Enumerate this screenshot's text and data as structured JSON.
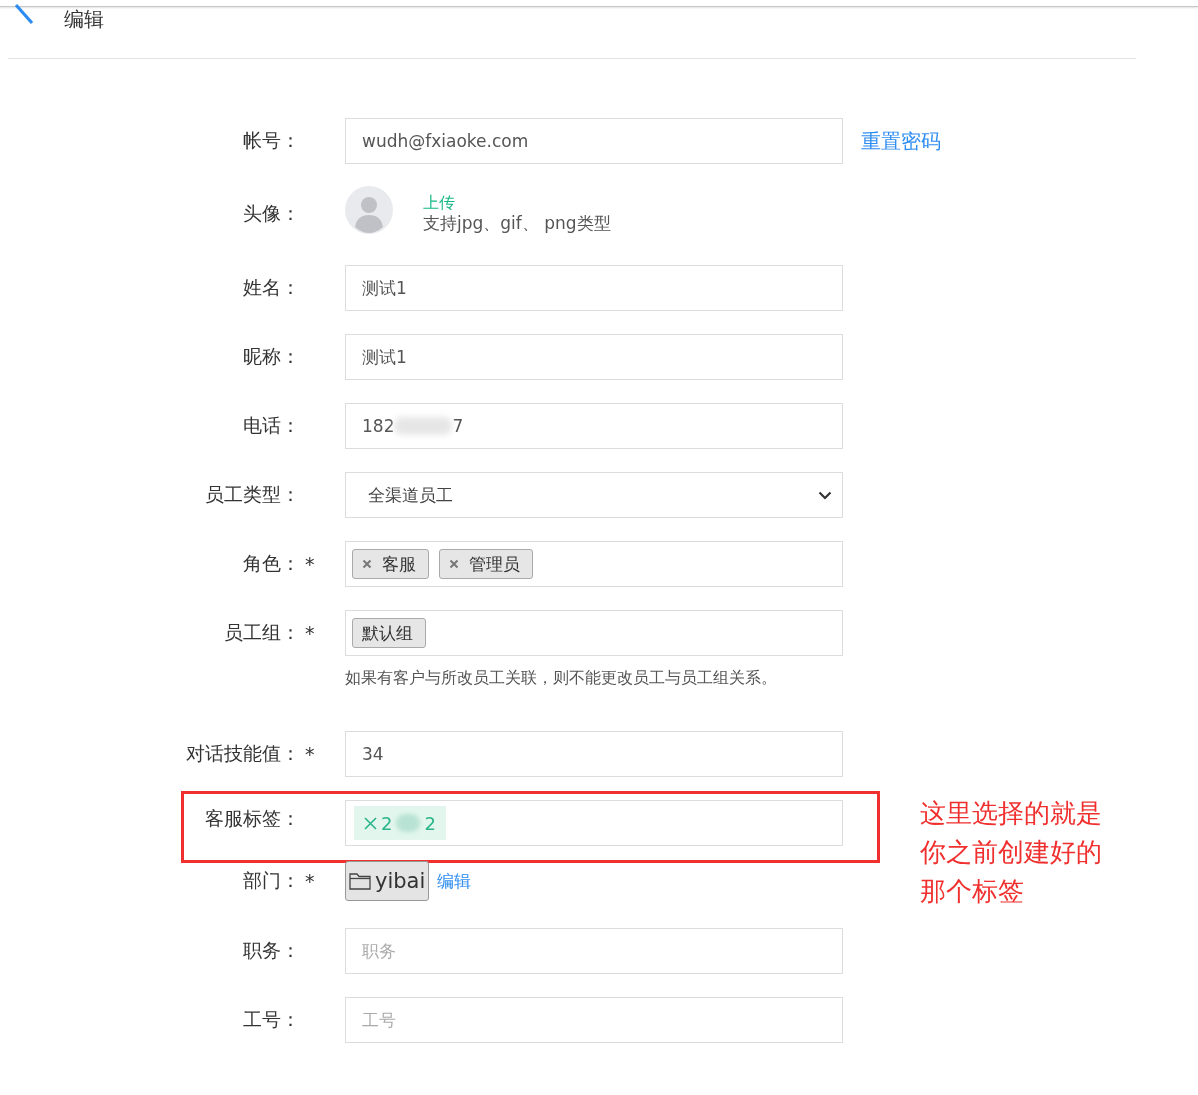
{
  "header": {
    "title": "编辑"
  },
  "fields": [
    {
      "kind": "text",
      "label": "帐号：",
      "value": "wudh@fxiaoke.com",
      "link": "重置密码"
    },
    {
      "kind": "avatar",
      "label": "头像：",
      "upload": "上传",
      "hint": "支持jpg、gif、 png类型"
    },
    {
      "kind": "text",
      "label": "姓名：",
      "value": "测试1"
    },
    {
      "kind": "text",
      "label": "昵称：",
      "value": "测试1"
    },
    {
      "kind": "masked",
      "label": "电话：",
      "value_start": "182",
      "value_end": "7"
    },
    {
      "kind": "select",
      "label": "员工类型：",
      "value": "全渠道员工"
    },
    {
      "kind": "chips",
      "label": "角色：",
      "mark": "*",
      "chips": [
        "客服",
        "管理员"
      ]
    },
    {
      "kind": "group",
      "label": "员工组：",
      "mark": "*",
      "chips": [
        "默认组"
      ],
      "note": "如果有客户与所改员工关联，则不能更改员工与员工组关系。"
    },
    {
      "kind": "text",
      "label": "对话技能值：",
      "mark": "*",
      "value": "34"
    },
    {
      "kind": "tag",
      "label": "客服标签：",
      "highlighted": true,
      "tag_start": "2",
      "tag_end": "2"
    },
    {
      "kind": "folder",
      "label": "部门：",
      "mark": "*",
      "value": "yibai",
      "link": "编辑"
    },
    {
      "kind": "text",
      "label": "职务：",
      "placeholder": "职务"
    },
    {
      "kind": "text",
      "label": "工号：",
      "placeholder": "工号"
    }
  ],
  "annotation": "这里选择的就是你之前创建好的那个标签"
}
